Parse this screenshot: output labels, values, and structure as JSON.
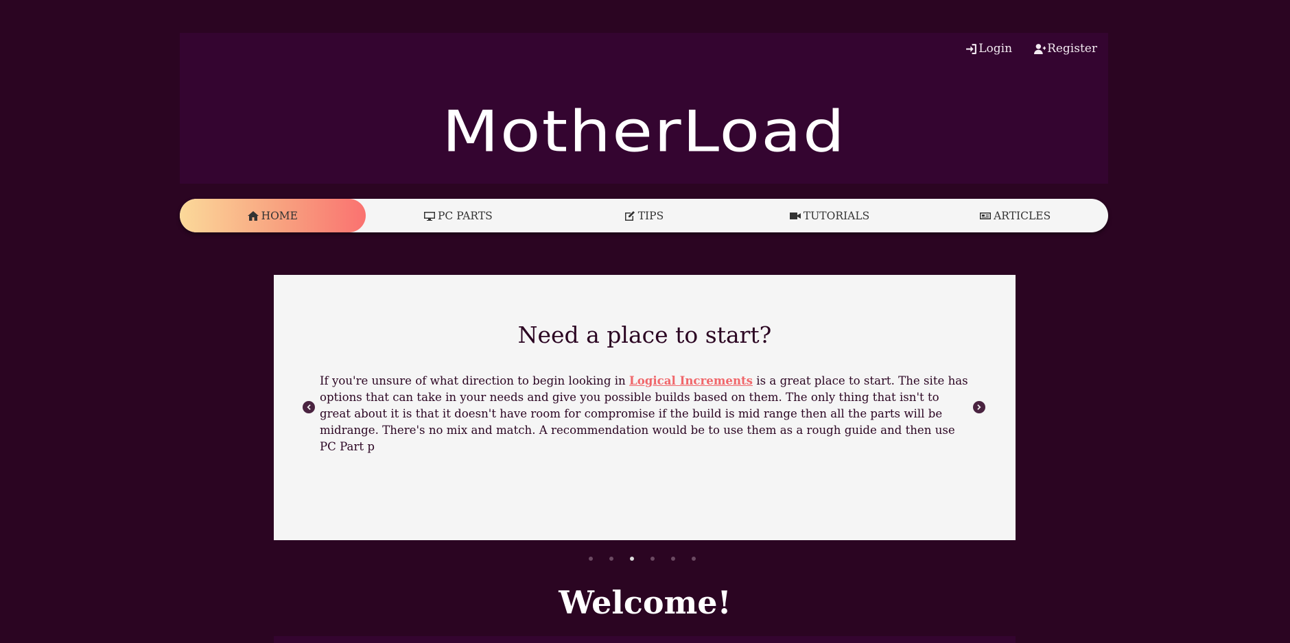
{
  "header": {
    "login_label": "Login",
    "register_label": "Register",
    "logo_text": "MotherLoad"
  },
  "nav": {
    "items": [
      {
        "label": "HOME",
        "icon": "home-icon"
      },
      {
        "label": "PC PARTS",
        "icon": "desktop-icon"
      },
      {
        "label": "TIPS",
        "icon": "edit-icon"
      },
      {
        "label": "TUTORIALS",
        "icon": "video-icon"
      },
      {
        "label": "ARTICLES",
        "icon": "newspaper-icon"
      }
    ],
    "active_index": 0
  },
  "carousel": {
    "title": "Need a place to start?",
    "text_before": "If you're unsure of what direction to begin looking in ",
    "link_text": "Logical Increments",
    "text_after": " is a great place to start. The site has options that can take in your needs and give you possible builds based on them. The only thing that isn't to great about it is that it doesn't have room for compromise if the build is mid range then all the parts will be midrange. There's no mix and match. A recommendation would be to use them as a rough guide and then use PC Part p",
    "slide_count": 6,
    "active_slide": 2
  },
  "welcome": {
    "heading": "Welcome!"
  },
  "colors": {
    "background": "#2b0522",
    "header_bg": "#340530",
    "link": "#f0676b",
    "nav_active_gradient": [
      "#fbd99a",
      "#fa7270"
    ]
  }
}
